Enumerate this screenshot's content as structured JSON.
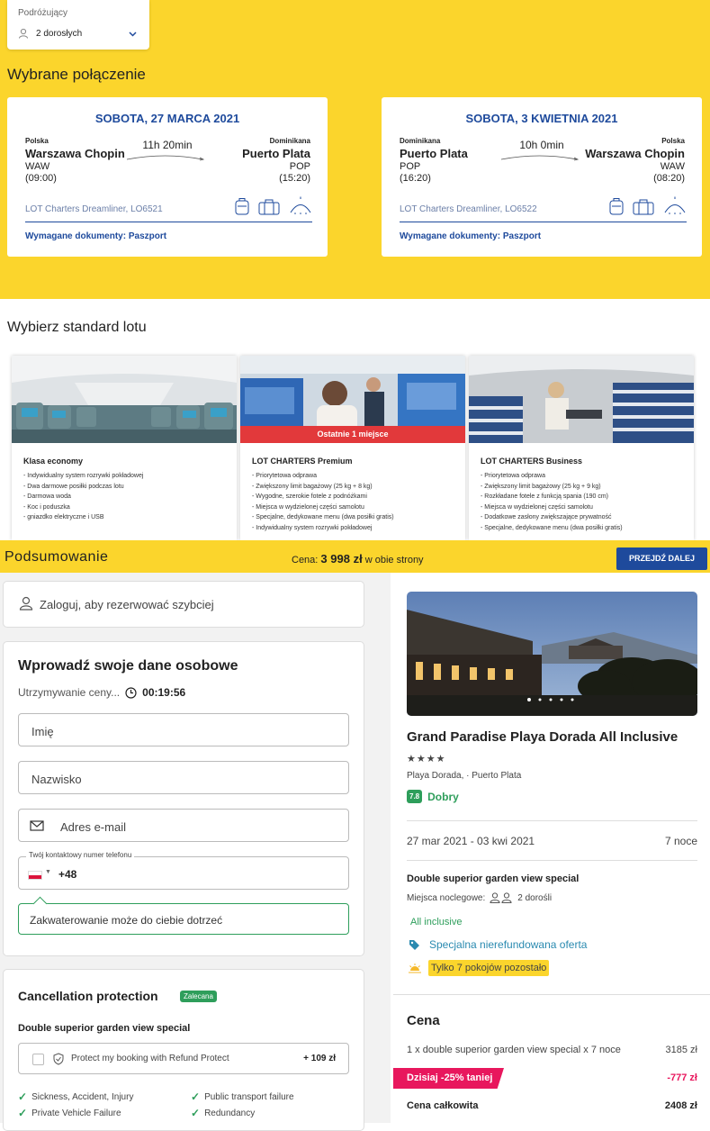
{
  "traveller": {
    "label": "Podróżujący",
    "value": "2 dorosłych"
  },
  "selected_title": "Wybrane połączenie",
  "flights": [
    {
      "date": "SOBOTA, 27 MARCA 2021",
      "from_country": "Polska",
      "from_city": "Warszawa Chopin",
      "from_code": "WAW",
      "from_time": "(09:00)",
      "duration": "11h 20min",
      "to_country": "Dominikana",
      "to_city": "Puerto Plata",
      "to_code": "POP",
      "to_time": "(15:20)",
      "plane": "LOT Charters Dreamliner, LO6521",
      "docs": "Wymagane dokumenty: Paszport"
    },
    {
      "date": "SOBOTA, 3 KWIETNIA 2021",
      "from_country": "Dominikana",
      "from_city": "Puerto Plata",
      "from_code": "POP",
      "from_time": "(16:20)",
      "duration": "10h 0min",
      "to_country": "Polska",
      "to_city": "Warszawa Chopin",
      "to_code": "WAW",
      "to_time": "(08:20)",
      "plane": "LOT Charters Dreamliner, LO6522",
      "docs": "Wymagane dokumenty: Paszport"
    }
  ],
  "standard_title": "Wybierz standard lotu",
  "standards": [
    {
      "name": "Klasa economy",
      "badge": "",
      "features": [
        "- Indywidualny system rozrywki pokładowej",
        "- Dwa darmowe posiłki podczas lotu",
        "- Darmowa woda",
        "- Koc i poduszka",
        "- gniazdko elektryczne i USB"
      ]
    },
    {
      "name": "LOT CHARTERS Premium",
      "badge": "Ostatnie 1 miejsce",
      "features": [
        "- Priorytetowa odprawa",
        "- Zwiększony limit bagażowy (25 kg + 8 kg)",
        "- Wygodne, szerokie fotele z podnóżkami",
        "- Miejsca w wydzielonej części samolotu",
        "- Specjalne, dedykowane menu (dwa posiłki gratis)",
        "- Indywidualny system rozrywki pokładowej"
      ]
    },
    {
      "name": "LOT CHARTERS Business",
      "badge": "",
      "features": [
        "- Priorytetowa odprawa",
        "- Zwiększony limit bagażowy (25 kg + 9 kg)",
        "- Rozkładane fotele z funkcją spania (190 cm)",
        "- Miejsca w wydzielonej części samolotu",
        "- Dodatkowe zasłony zwiększające prywatność",
        "- Specjalne, dedykowane menu (dwa posiłki gratis)"
      ]
    }
  ],
  "summary": {
    "title": "Podsumowanie",
    "price_label": "Cena:",
    "price": "3 998 zł",
    "price_suffix": "w obie strony",
    "next_button": "PRZEJDŹ DALEJ"
  },
  "login_text": "Zaloguj, aby rezerwować szybciej",
  "personal": {
    "title": "Wprowadź swoje dane osobowe",
    "hold_label": "Utrzymywanie ceny...",
    "hold_time": "00:19:56",
    "first_name_ph": "Imię",
    "last_name_ph": "Nazwisko",
    "email_ph": "Adres e-mail",
    "phone_label": "Twój kontaktowy numer telefonu",
    "phone_prefix": "+48",
    "tip": "Zakwaterowanie może do ciebie dotrzeć"
  },
  "cancellation": {
    "title": "Cancellation protection",
    "badge": "Zalecana",
    "room": "Double superior garden view special",
    "option_label": "Protect my booking with Refund Protect",
    "option_price": "+ 109 zł",
    "benefits": [
      "Sickness, Accident, Injury",
      "Public transport failure",
      "Private Vehicle Failure",
      "Redundancy"
    ]
  },
  "hotel": {
    "name": "Grand Paradise Playa Dorada All Inclusive",
    "stars": "★★★★",
    "location": "Playa Dorada, · Puerto Plata",
    "rating_score": "7.8",
    "rating_word": "Dobry",
    "dates": "27 mar 2021 - 03 kwi 2021",
    "nights": "7 noce",
    "room": "Double superior garden view special",
    "guests_label": "Miejsca noclegowe:",
    "guests_value": "2 dorośli",
    "board": "All inclusive",
    "special": "Specjalna nierefundowana oferta",
    "rooms_left": "Tylko 7 pokojów pozostało"
  },
  "price_box": {
    "title": "Cena",
    "line_label": "1 x double superior garden view special x 7 noce",
    "line_value": "3185 zł",
    "discount_label": "Dzisiaj -25% taniej",
    "discount_value": "-777 zł",
    "total_label": "Cena całkowita",
    "total_value": "2408 zł"
  },
  "colors": {
    "accent_yellow": "#fbd52c",
    "lot_blue": "#1e4a9c",
    "green": "#2e9e5b",
    "discount_pink": "#e8175d",
    "badge_red": "#e2393b"
  }
}
